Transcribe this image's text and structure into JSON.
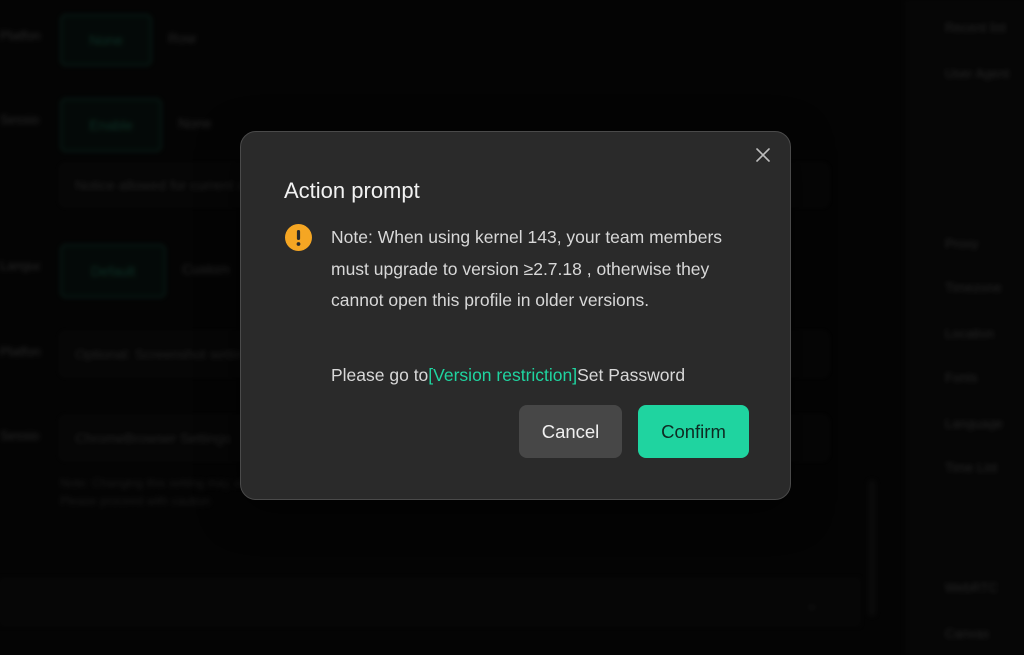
{
  "background": {
    "rows": [
      {
        "label": "Platform",
        "button": "None",
        "option": "Row"
      },
      {
        "label": "Session",
        "button": "Enable",
        "option": "None"
      },
      {
        "label": "Language",
        "button": "Default",
        "option": "Custom"
      }
    ],
    "field_notice": "Notice allowed for current device",
    "field_optional": "Optional: Screenshot settings",
    "field_browser": "ChromeBrowser Settings",
    "hint_lines": [
      "Note: Changing this setting may affect",
      "Please proceed with caution"
    ],
    "right_panel_items": [
      "Recent list",
      "User Agent",
      "Proxy",
      "Timezone",
      "Location",
      "Fonts",
      "Language",
      "Time List",
      "WebRTC",
      "Canvas"
    ]
  },
  "modal": {
    "title": "Action prompt",
    "message": "Note: When using kernel 143, your team members must upgrade to version ≥2.7.18 , otherwise they cannot open this profile in older versions.",
    "goto_prefix": "Please go to",
    "goto_link": "[Version restriction]",
    "goto_suffix": "Set Password",
    "cancel_label": "Cancel",
    "confirm_label": "Confirm",
    "icons": {
      "close": "close-icon",
      "warning": "warning-icon"
    }
  },
  "colors": {
    "accent": "#1fd4a0",
    "warning": "#f5a623",
    "modal_bg": "#2a2a2a",
    "cancel_bg": "#474747"
  }
}
